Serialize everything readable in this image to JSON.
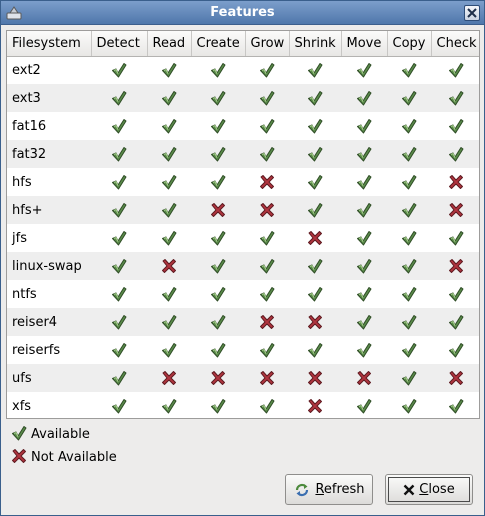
{
  "window": {
    "title": "Features"
  },
  "columns": [
    "Filesystem",
    "Detect",
    "Read",
    "Create",
    "Grow",
    "Shrink",
    "Move",
    "Copy",
    "Check"
  ],
  "rows": [
    {
      "name": "ext2",
      "flags": [
        1,
        1,
        1,
        1,
        1,
        1,
        1,
        1
      ]
    },
    {
      "name": "ext3",
      "flags": [
        1,
        1,
        1,
        1,
        1,
        1,
        1,
        1
      ]
    },
    {
      "name": "fat16",
      "flags": [
        1,
        1,
        1,
        1,
        1,
        1,
        1,
        1
      ]
    },
    {
      "name": "fat32",
      "flags": [
        1,
        1,
        1,
        1,
        1,
        1,
        1,
        1
      ]
    },
    {
      "name": "hfs",
      "flags": [
        1,
        1,
        1,
        0,
        1,
        1,
        1,
        0
      ]
    },
    {
      "name": "hfs+",
      "flags": [
        1,
        1,
        0,
        0,
        1,
        1,
        1,
        0
      ]
    },
    {
      "name": "jfs",
      "flags": [
        1,
        1,
        1,
        1,
        0,
        1,
        1,
        1
      ]
    },
    {
      "name": "linux-swap",
      "flags": [
        1,
        0,
        1,
        1,
        1,
        1,
        1,
        0
      ]
    },
    {
      "name": "ntfs",
      "flags": [
        1,
        1,
        1,
        1,
        1,
        1,
        1,
        1
      ]
    },
    {
      "name": "reiser4",
      "flags": [
        1,
        1,
        1,
        0,
        0,
        1,
        1,
        1
      ]
    },
    {
      "name": "reiserfs",
      "flags": [
        1,
        1,
        1,
        1,
        1,
        1,
        1,
        1
      ]
    },
    {
      "name": "ufs",
      "flags": [
        1,
        0,
        0,
        0,
        0,
        0,
        1,
        0
      ]
    },
    {
      "name": "xfs",
      "flags": [
        1,
        1,
        1,
        1,
        0,
        1,
        1,
        1
      ]
    }
  ],
  "legend": {
    "available": "Available",
    "not_available": "Not Available"
  },
  "buttons": {
    "refresh_underline": "R",
    "refresh_rest": "efresh",
    "close_underline": "C",
    "close_rest": "lose"
  },
  "colors": {
    "check": "#5a8a4a",
    "cross": "#b0353f",
    "titlebar": "#5b82b5"
  },
  "icons": {
    "available": "check-icon",
    "not_available": "cross-icon",
    "refresh": "refresh-icon",
    "close": "close-icon"
  }
}
